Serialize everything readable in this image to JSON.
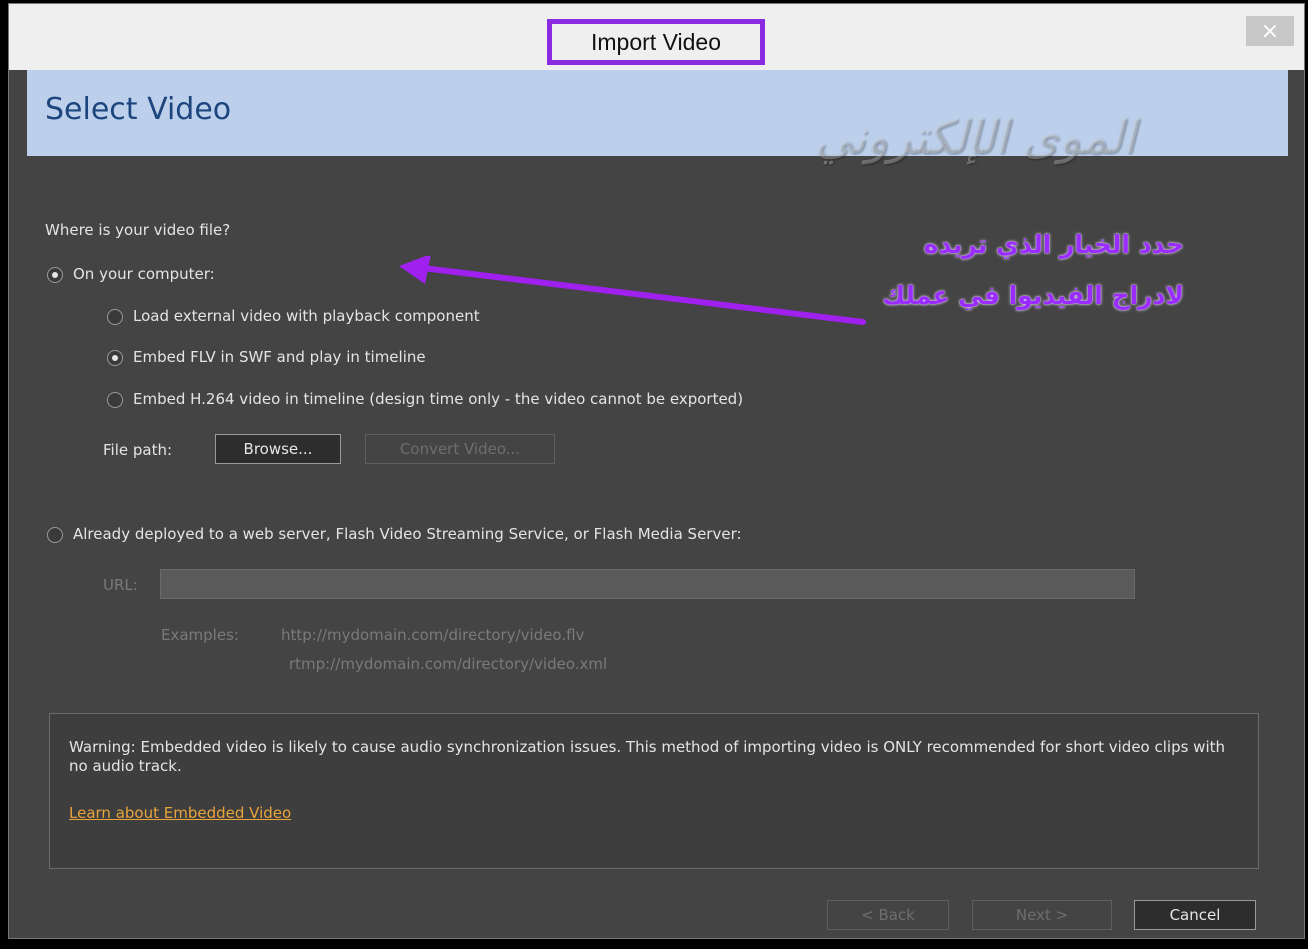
{
  "window": {
    "title": "Import Video",
    "close_glyph": "×",
    "header_title": "Select Video",
    "watermark": "الموى الإلكتروني"
  },
  "source": {
    "question": "Where is your video file?",
    "on_computer_label": "On your computer:",
    "options": [
      {
        "label": "Load external video with playback component",
        "checked": false
      },
      {
        "label": "Embed FLV in SWF and play in timeline",
        "checked": true
      },
      {
        "label": "Embed H.264 video in timeline (design time only - the video cannot be exported)",
        "checked": false
      }
    ],
    "file_path_label": "File path:",
    "browse_label": "Browse...",
    "convert_label": "Convert Video..."
  },
  "server": {
    "label": "Already deployed to a web server, Flash Video Streaming Service, or Flash Media Server:",
    "url_label": "URL:",
    "url_value": "",
    "examples_label": "Examples:",
    "example_1": "http://mydomain.com/directory/video.flv",
    "example_2": "rtmp://mydomain.com/directory/video.xml"
  },
  "warning": {
    "text": "Warning: Embedded video is likely to cause audio synchronization issues. This method of importing video is ONLY recommended for short video clips with no audio track.",
    "link": "Learn about Embedded Video"
  },
  "footer": {
    "back_label": "< Back",
    "next_label": "Next >",
    "cancel_label": "Cancel"
  },
  "annotation": {
    "line_1": "حدد الخيار الذي تريده",
    "line_2": "لادراج الفيديوا في عملك",
    "color": "#9b2cff"
  },
  "colors": {
    "dialog_bg": "#444444",
    "header_bg": "#bcd0ec",
    "header_text": "#1e467e",
    "title_highlight": "#8a2be2",
    "link": "#e8a43c"
  }
}
